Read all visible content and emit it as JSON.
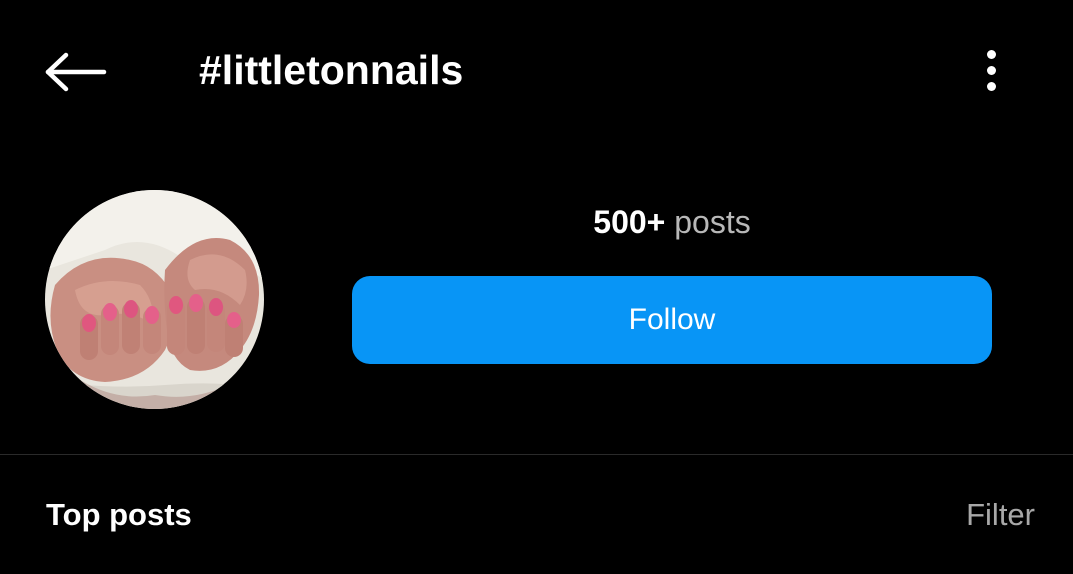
{
  "header": {
    "back_icon": "arrow-left-icon",
    "title": "#littletonnails",
    "more_icon": "vertical-ellipsis-icon"
  },
  "profile": {
    "avatar_description_icon": "hashtag-avatar-image",
    "posts_count": "500+",
    "posts_label": " posts",
    "follow_label": "Follow"
  },
  "section": {
    "title": "Top posts",
    "filter_label": "Filter"
  },
  "colors": {
    "background": "#000000",
    "accent": "#0895f6",
    "secondary_text": "#a8a8a8"
  }
}
